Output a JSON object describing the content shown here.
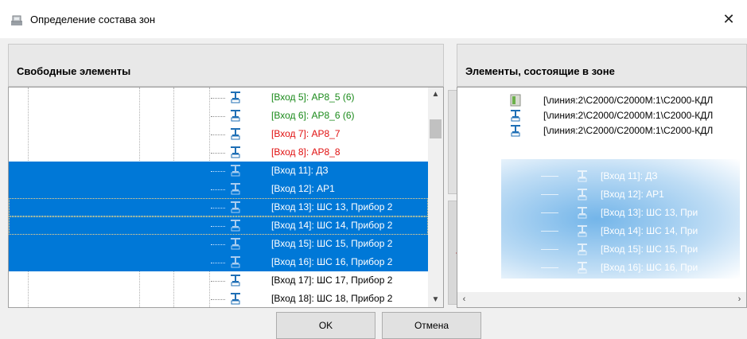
{
  "window": {
    "title": "Определение состава зон",
    "close_glyph": "✕"
  },
  "left_panel": {
    "header": "Свободные элементы"
  },
  "right_panel": {
    "header": "Элементы, состоящие в зоне"
  },
  "left_list": [
    {
      "text": "[Вход 5]: АР8_5  (6)",
      "color": "green",
      "selected": false
    },
    {
      "text": "[Вход 6]: АР8_6  (6)",
      "color": "green",
      "selected": false
    },
    {
      "text": "[Вход 7]: АР8_7",
      "color": "red",
      "selected": false
    },
    {
      "text": "[Вход 8]: АР8_8",
      "color": "red",
      "selected": false
    },
    {
      "text": "[Вход 11]: ДЗ",
      "color": "white",
      "selected": true
    },
    {
      "text": "[Вход 12]: АР1",
      "color": "white",
      "selected": true
    },
    {
      "text": "[Вход 13]: ШС 13, Прибор 2",
      "color": "white",
      "selected": true
    },
    {
      "text": "[Вход 14]: ШС 14, Прибор 2",
      "color": "white",
      "selected": true
    },
    {
      "text": "[Вход 15]: ШС 15, Прибор 2",
      "color": "white",
      "selected": true
    },
    {
      "text": "[Вход 16]: ШС 16, Прибор 2",
      "color": "white",
      "selected": true
    },
    {
      "text": "[Вход 17]: ШС 17, Прибор 2",
      "color": "black",
      "selected": false
    },
    {
      "text": "[Вход 18]: ШС 18, Прибор 2",
      "color": "black",
      "selected": false
    }
  ],
  "right_list": [
    {
      "text": "[\\линия:2\\С2000/С2000М:1\\С2000-КДЛ",
      "icon": "device-icon"
    },
    {
      "text": "[\\линия:2\\С2000/С2000М:1\\С2000-КДЛ",
      "icon": "sensor-icon"
    },
    {
      "text": "[\\линия:2\\С2000/С2000М:1\\С2000-КДЛ",
      "icon": "sensor-icon"
    }
  ],
  "drag_preview": [
    "[Вход 11]: ДЗ",
    "[Вход 12]: АР1",
    "[Вход 13]: ШС 13, При",
    "[Вход 14]: ШС 14, При",
    "[Вход 15]: ШС 15, При",
    "[Вход 16]: ШС 16, При"
  ],
  "buttons": {
    "add": "»",
    "remove": "«",
    "ok": "OK",
    "cancel": "Отмена"
  },
  "colors": {
    "selection": "#0078d7",
    "green_text": "#1a8a1a",
    "red_text": "#e01010",
    "arrow_add": "#1565c0",
    "arrow_remove": "#b54a4a"
  }
}
